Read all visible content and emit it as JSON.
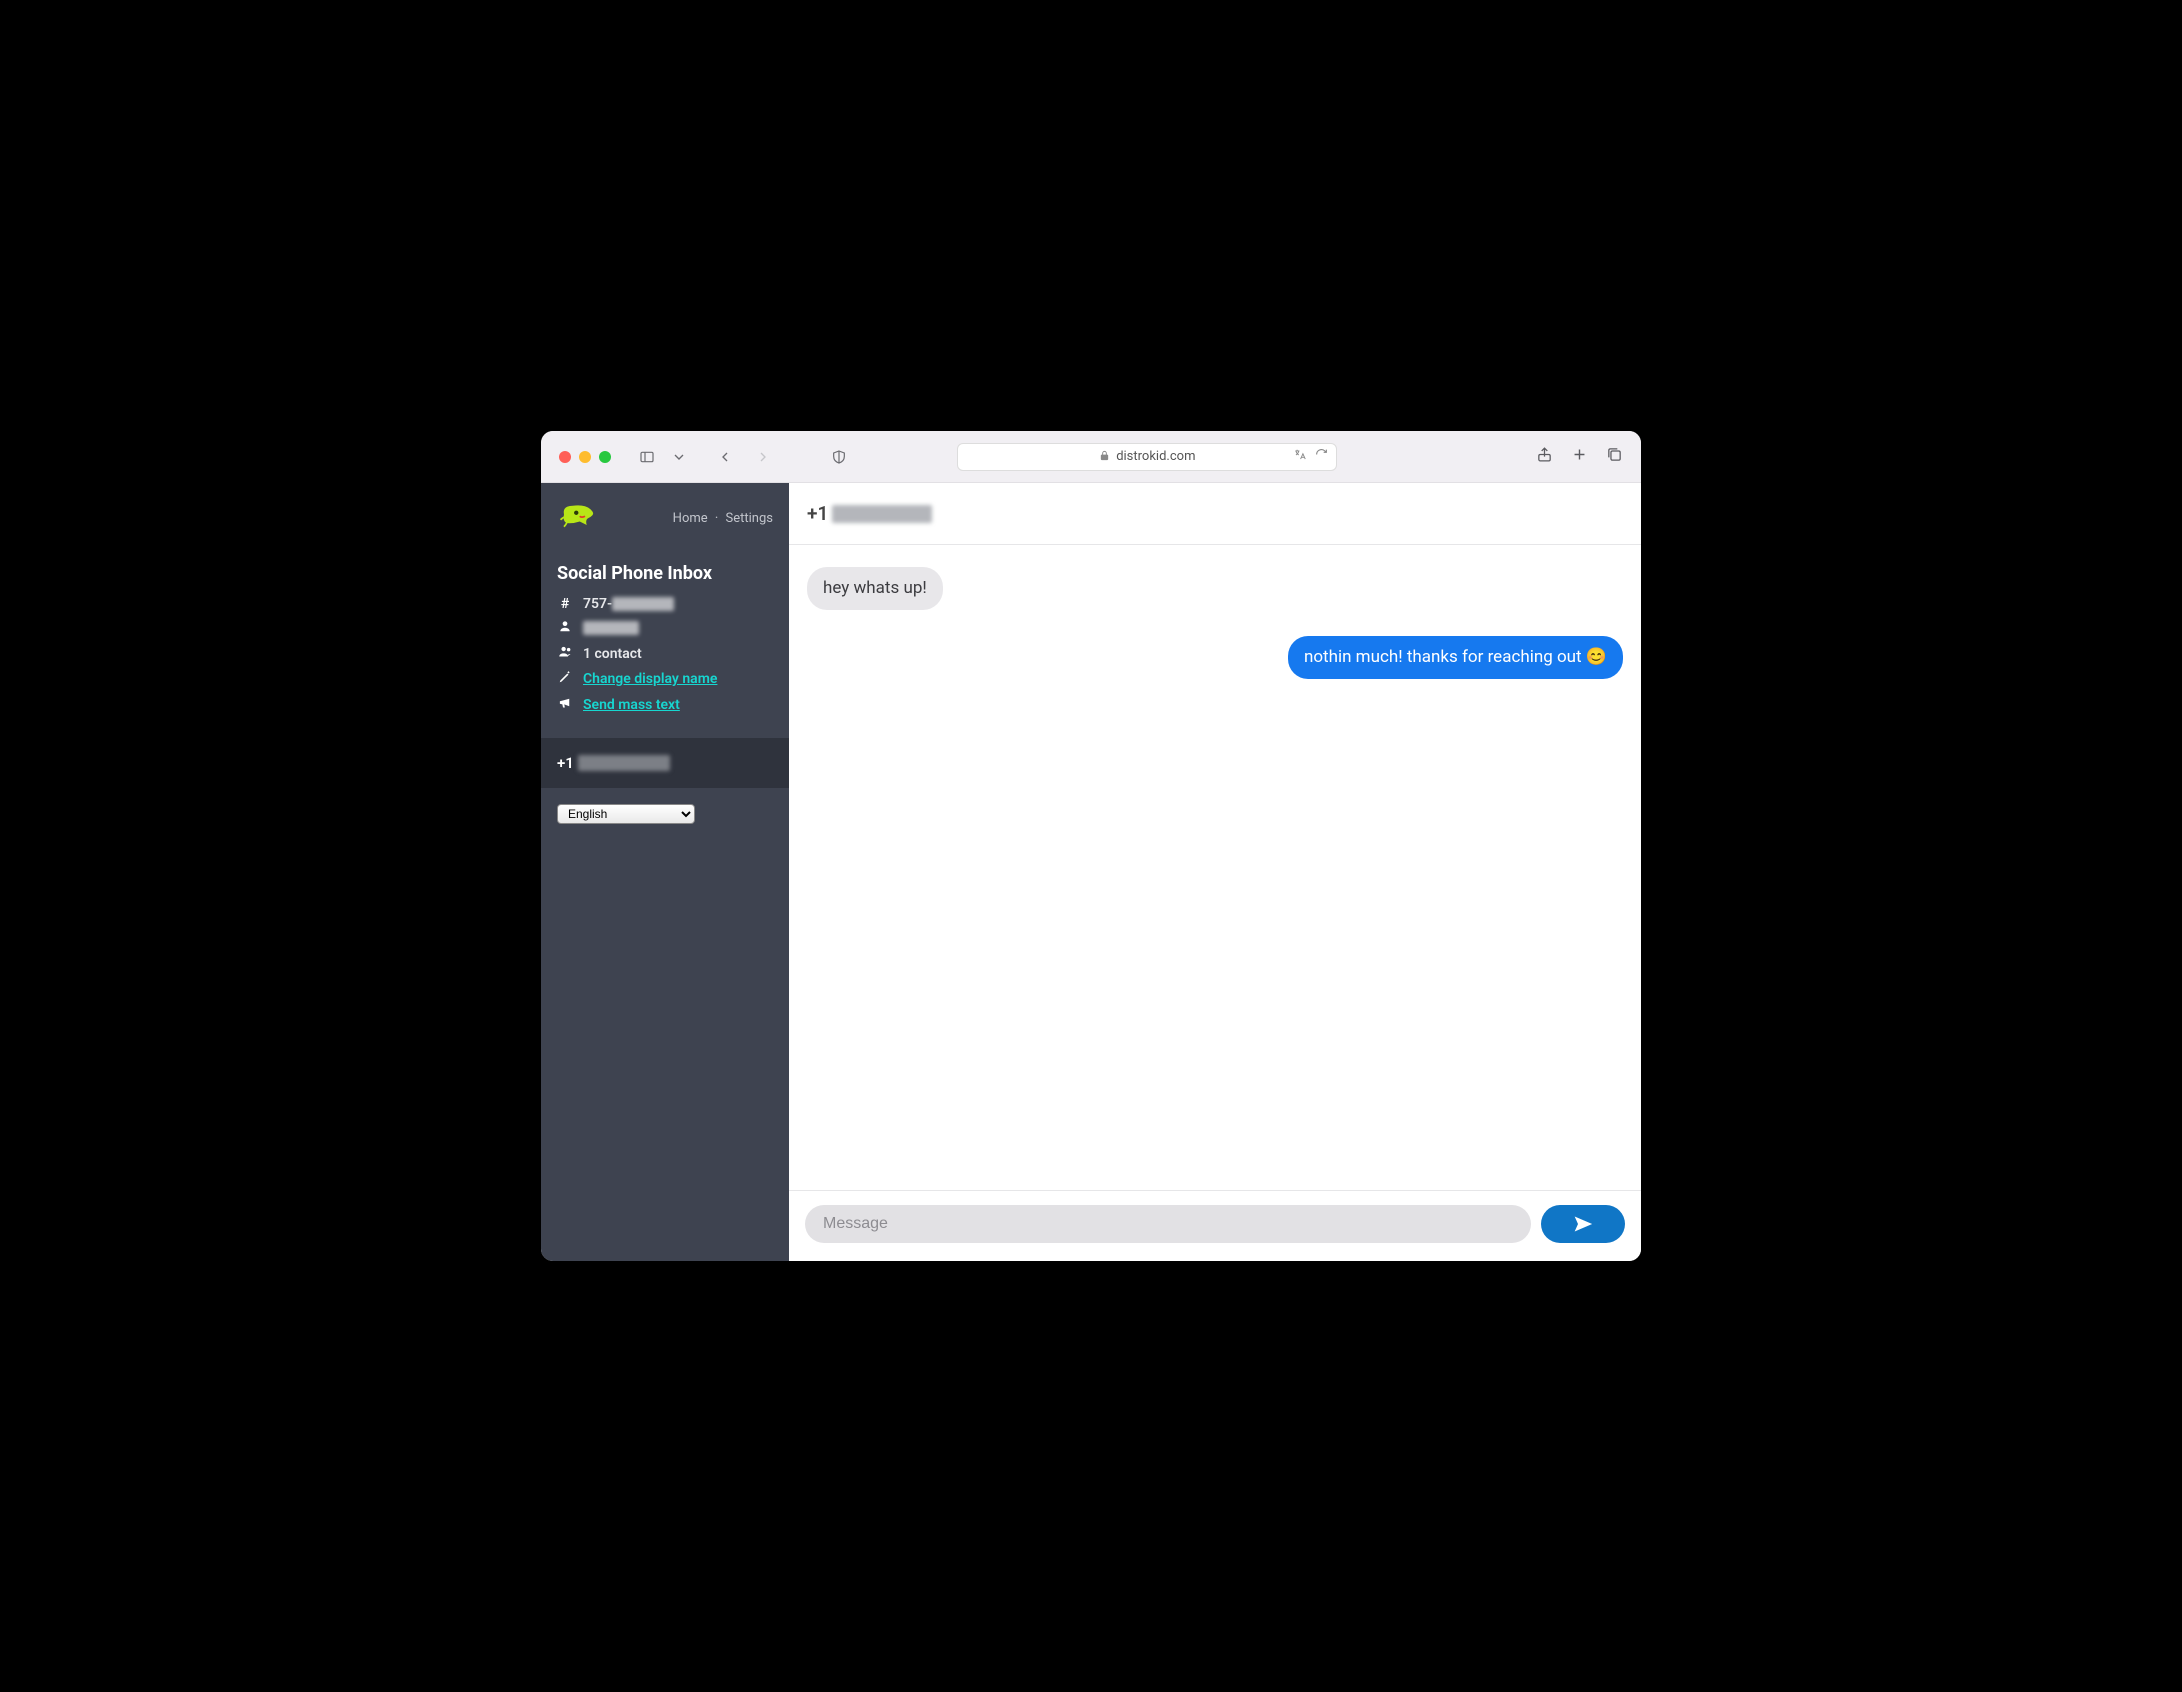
{
  "browser": {
    "domain": "distrokid.com"
  },
  "sidebar": {
    "nav": {
      "home": "Home",
      "settings": "Settings"
    },
    "title": "Social Phone Inbox",
    "phone_prefix": "757-",
    "contacts_count": "1 contact",
    "change_name": "Change display name",
    "mass_text": "Send mass text",
    "contact_prefix": "+1",
    "language": "English"
  },
  "header": {
    "number_prefix": "+1"
  },
  "messages": {
    "incoming_0": "hey whats up!",
    "outgoing_0": "nothin much! thanks for reaching out 😊"
  },
  "composer": {
    "placeholder": "Message"
  }
}
